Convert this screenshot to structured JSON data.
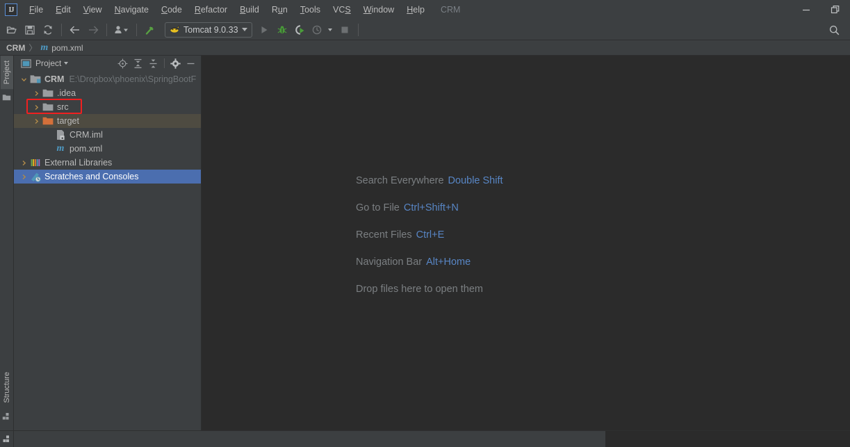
{
  "window": {
    "app_logo": "intellij-idea-logo",
    "project_label": "CRM",
    "minimize": "—",
    "restore": "restore"
  },
  "menubar": {
    "items": [
      {
        "label": "File",
        "mnemonic": "F"
      },
      {
        "label": "Edit",
        "mnemonic": "E"
      },
      {
        "label": "View",
        "mnemonic": "V"
      },
      {
        "label": "Navigate",
        "mnemonic": "N"
      },
      {
        "label": "Code",
        "mnemonic": "C"
      },
      {
        "label": "Refactor",
        "mnemonic": "R"
      },
      {
        "label": "Build",
        "mnemonic": "B"
      },
      {
        "label": "Run",
        "mnemonic": "u"
      },
      {
        "label": "Tools",
        "mnemonic": "T"
      },
      {
        "label": "VCS",
        "mnemonic": "S"
      },
      {
        "label": "Window",
        "mnemonic": "W"
      },
      {
        "label": "Help",
        "mnemonic": "H"
      }
    ]
  },
  "toolbar": {
    "open_title": "open-folder",
    "save_title": "save-all",
    "sync_title": "synchronize",
    "back_title": "navigate-back",
    "forward_title": "navigate-forward",
    "profile_title": "user-profile",
    "build_title": "build-project",
    "run_config": "Tomcat 9.0.33",
    "run_title": "run",
    "debug_title": "debug",
    "coverage_title": "run-with-coverage",
    "profiler_title": "profiler",
    "stop_title": "stop",
    "search_title": "search"
  },
  "breadcrumb": {
    "root": "CRM",
    "separator": "〉",
    "file_icon": "m",
    "file": "pom.xml"
  },
  "left_rail": {
    "top_tab": "Project",
    "bottom_tab": "Structure"
  },
  "project_panel": {
    "title": "Project",
    "icons": {
      "locate": "locate-icon",
      "expand": "expand-all-icon",
      "collapse": "collapse-all-icon",
      "settings": "gear-icon",
      "hide": "hide-icon"
    },
    "tree": [
      {
        "label": "CRM",
        "path": "E:\\Dropbox\\phoenix\\SpringBootF",
        "icon": "module-folder",
        "arrow": "expanded",
        "indent": 0,
        "bold": true,
        "state": "normal"
      },
      {
        "label": ".idea",
        "icon": "folder",
        "arrow": "collapsed",
        "indent": 1,
        "bold": false,
        "state": "normal"
      },
      {
        "label": "src",
        "icon": "folder",
        "arrow": "collapsed",
        "indent": 1,
        "bold": false,
        "state": "highlighted"
      },
      {
        "label": "target",
        "icon": "folder-orange",
        "arrow": "collapsed",
        "indent": 1,
        "bold": false,
        "state": "marked"
      },
      {
        "label": "CRM.iml",
        "icon": "iml-file",
        "arrow": "none",
        "indent": 2,
        "bold": false,
        "state": "normal"
      },
      {
        "label": "pom.xml",
        "icon": "maven-file",
        "arrow": "none",
        "indent": 2,
        "bold": false,
        "state": "normal"
      },
      {
        "label": "External Libraries",
        "icon": "libraries",
        "arrow": "collapsed",
        "indent": 0,
        "bold": false,
        "state": "normal"
      },
      {
        "label": "Scratches and Consoles",
        "icon": "scratches",
        "arrow": "collapsed",
        "indent": 0,
        "bold": false,
        "state": "selected"
      }
    ]
  },
  "editor": {
    "hints": [
      {
        "action": "Search Everywhere",
        "key": "Double Shift"
      },
      {
        "action": "Go to File",
        "key": "Ctrl+Shift+N"
      },
      {
        "action": "Recent Files",
        "key": "Ctrl+E"
      },
      {
        "action": "Navigation Bar",
        "key": "Alt+Home"
      },
      {
        "action": "Drop files here to open them",
        "key": ""
      }
    ]
  },
  "colors": {
    "panel_bg": "#3c3f41",
    "editor_bg": "#2b2b2b",
    "selection": "#4b6eaf",
    "marked_row": "#4e4b41",
    "highlight_border": "#f02020",
    "link_blue": "#5886c5",
    "text": "#bbbbbb"
  }
}
